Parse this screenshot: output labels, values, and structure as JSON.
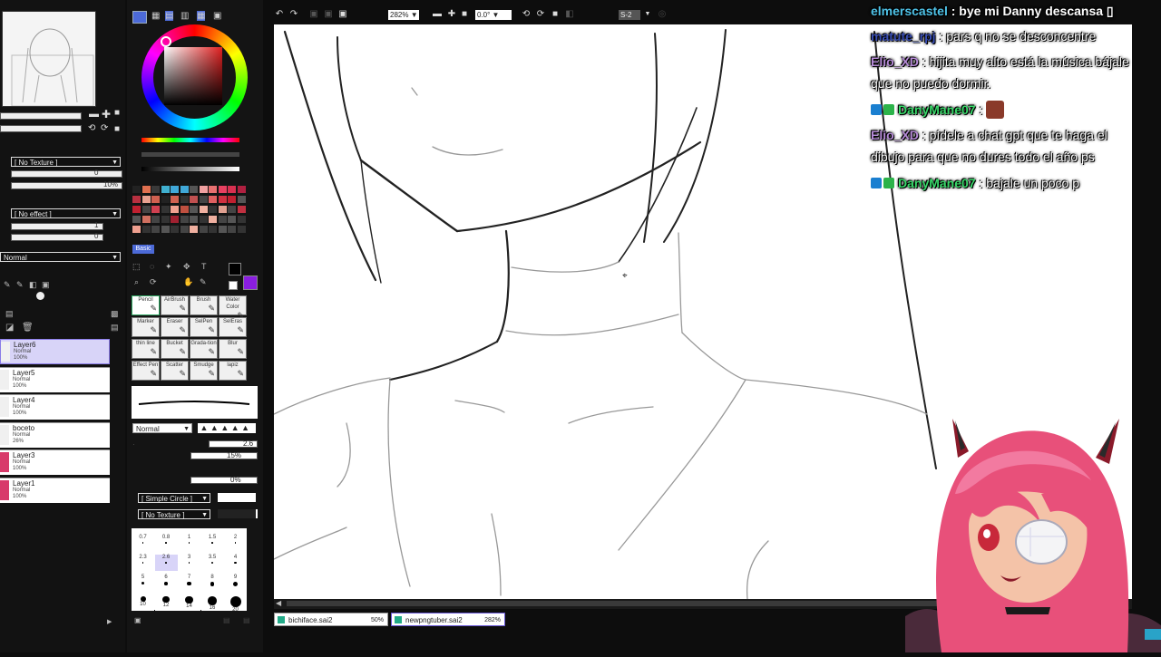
{
  "left_panel": {
    "texture_dropdown": "[ No Texture ]",
    "texture_value": "0",
    "texture_percent": "10%",
    "effect_dropdown": "[ No effect ]",
    "effect_value_1": "1",
    "effect_value_2": "0",
    "blend_mode": "Normal",
    "layers": [
      {
        "name": "Layer6",
        "mode": "Normal",
        "opacity": "100%",
        "selected": true
      },
      {
        "name": "Layer5",
        "mode": "Normal",
        "opacity": "100%",
        "selected": false
      },
      {
        "name": "Layer4",
        "mode": "Normal",
        "opacity": "100%",
        "selected": false
      },
      {
        "name": "boceto",
        "mode": "Normal",
        "opacity": "26%",
        "selected": false
      },
      {
        "name": "Layer3",
        "mode": "Normal",
        "opacity": "100%",
        "selected": false
      },
      {
        "name": "Layer1",
        "mode": "Normal",
        "opacity": "100%",
        "selected": false
      }
    ]
  },
  "tool_panel": {
    "color_tab": "Basic",
    "tools": [
      {
        "label": "Pencil",
        "active": true
      },
      {
        "label": "AirBrush",
        "active": false
      },
      {
        "label": "Brush",
        "active": false
      },
      {
        "label": "Water Color",
        "active": false
      },
      {
        "label": "Marker",
        "active": false
      },
      {
        "label": "Eraser",
        "active": false
      },
      {
        "label": "SelPen",
        "active": false
      },
      {
        "label": "SelEras",
        "active": false
      },
      {
        "label": "thin line",
        "active": false
      },
      {
        "label": "Bucket",
        "active": false
      },
      {
        "label": "Grada-tion",
        "active": false
      },
      {
        "label": "Blur",
        "active": false
      },
      {
        "label": "Effect Pen",
        "active": false
      },
      {
        "label": "Scatter",
        "active": false
      },
      {
        "label": "Smudge",
        "active": false
      },
      {
        "label": "lapiz",
        "active": false
      }
    ],
    "blend_mode": "Normal",
    "brush_size": "2.6",
    "min_size": "15%",
    "density": "0%",
    "shape_dropdown": "[ Simple Circle ]",
    "texture_dropdown": "[ No Texture ]",
    "brush_sizes": [
      "0.7",
      "0.8",
      "1",
      "1.5",
      "2",
      "2.3",
      "2.6",
      "3",
      "3.5",
      "4",
      "5",
      "6",
      "7",
      "8",
      "9",
      "10",
      "12",
      "14",
      "16",
      "20"
    ],
    "selected_brush_size": "2.6"
  },
  "toolbar": {
    "zoom": "282%",
    "rotation": "0.0°",
    "stabilizer": "S-2"
  },
  "doc_tabs": [
    {
      "name": "bichiface.sai2",
      "zoom": "50%"
    },
    {
      "name": "newpngtuber.sai2",
      "zoom": "282%"
    }
  ],
  "chat": [
    {
      "user": "elmerscastel",
      "user_color": "#4fc3e8",
      "message": ": bye mi Danny descansa ▯",
      "badges": false,
      "emote": false
    },
    {
      "user": "matute_rpj",
      "user_color": "#3a4fb5",
      "message": ": pars q no se desconcentre",
      "badges": false,
      "emote": false
    },
    {
      "user": "Elio_XD",
      "user_color": "#b58ad6",
      "message": ": hijita muy alto está la música bájale que no puedo dormir.",
      "badges": false,
      "emote": false
    },
    {
      "user": "DanyMane07",
      "user_color": "#39d96a",
      "message": ":",
      "badges": true,
      "emote": true
    },
    {
      "user": "Elio_XD",
      "user_color": "#b58ad6",
      "message": ": pídele a chat gpt que te haga el dibujo para que no dures todo el año ps",
      "badges": false,
      "emote": false
    },
    {
      "user": "DanyMane07",
      "user_color": "#39d96a",
      "message": ": bajale un poco p",
      "badges": true,
      "emote": false
    }
  ],
  "colors": {
    "selected_layer": "#d8d4f8",
    "primary_color": "#000000",
    "secondary_color": "#8a1ee0"
  }
}
